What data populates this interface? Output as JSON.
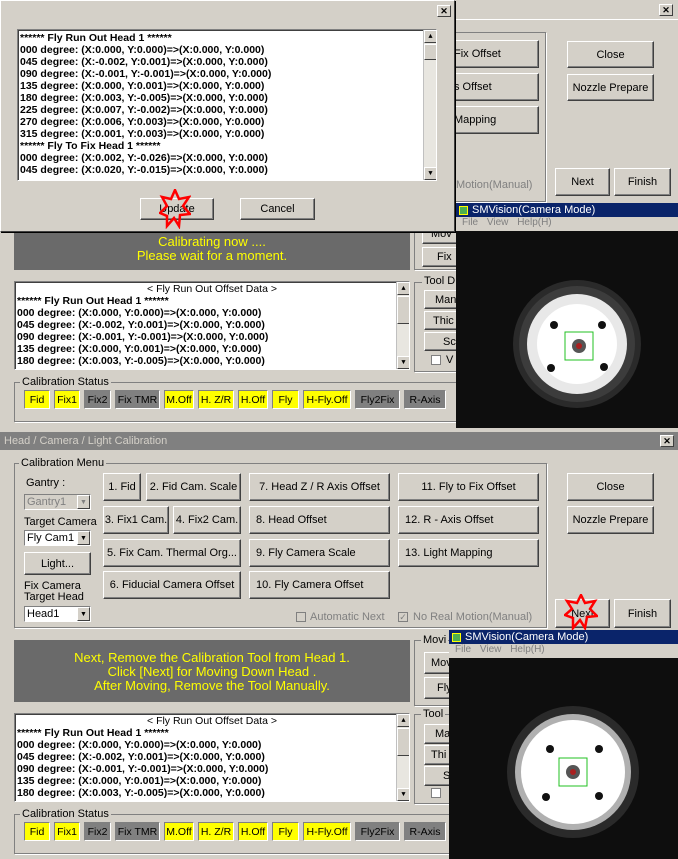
{
  "top": {
    "dialog": {
      "lines": [
        "****** Fly Run Out Head  1 ******",
        "000 degree: (X:0.000, Y:0.000)=>(X:0.000, Y:0.000)",
        "045 degree: (X:-0.002, Y:0.001)=>(X:0.000, Y:0.000)",
        "090 degree: (X:-0.001, Y:-0.001)=>(X:0.000, Y:0.000)",
        "135 degree: (X:0.000, Y:0.001)=>(X:0.000, Y:0.000)",
        "180 degree: (X:0.003, Y:-0.005)=>(X:0.000, Y:0.000)",
        "225 degree: (X:0.007, Y:-0.002)=>(X:0.000, Y:0.000)",
        "270 degree: (X:0.006, Y:0.003)=>(X:0.000, Y:0.000)",
        "315 degree: (X:0.001, Y:0.003)=>(X:0.000, Y:0.000)",
        "****** Fly To Fix Head  1 ******",
        "000 degree: (X:0.002, Y:-0.026)=>(X:0.000, Y:0.000)",
        "045 degree: (X:0.020, Y:-0.015)=>(X:0.000, Y:0.000)"
      ],
      "update_label": "Update",
      "cancel_label": "Cancel"
    },
    "right_buttons": {
      "fix_offset": "Fix Offset",
      "s_offset": "s Offset",
      "mapping": "Mapping",
      "close": "Close",
      "nozzle_prepare": "Nozzle Prepare",
      "next": "Next",
      "finish": "Finish",
      "motion_manual": "Motion(Manual)"
    },
    "message": "Calibrating now ....\nPlease wait for a moment.",
    "offset_title": "< Fly Run Out Offset Data >",
    "offset_lines": [
      "****** Fly Run Out Head  1 ******",
      "000 degree: (X:0.000, Y:0.000)=>(X:0.000, Y:0.000)",
      "045 degree: (X:-0.002, Y:0.001)=>(X:0.000, Y:0.000)",
      "090 degree: (X:-0.001, Y:-0.001)=>(X:0.000, Y:0.000)",
      "135 degree: (X:0.000, Y:0.001)=>(X:0.000, Y:0.000)",
      "180 degree: (X:0.003, Y:-0.005)=>(X:0.000, Y:0.000)"
    ],
    "side": {
      "mov": "Mov",
      "fix": "Fix",
      "tool": "Tool D",
      "man": "Man",
      "thic": "Thic",
      "sc": "Sc",
      "v": "V"
    },
    "camera": {
      "title": "SMVision(Camera Mode)",
      "menu": [
        "File",
        "View",
        "Help(H)"
      ]
    }
  },
  "bottom": {
    "window_title": "Head / Camera / Light Calibration",
    "menu_title": "Calibration Menu",
    "gantry_label": "Gantry :",
    "gantry_value": "Gantry1",
    "target_camera_label": "Target Camera",
    "target_camera_value": "Fly Cam1",
    "light_label": "Light...",
    "fix_camera_label": "Fix Camera",
    "target_head_label": "Target Head",
    "target_head_value": "Head1",
    "calib_buttons": [
      "1. Fid",
      "2. Fid Cam. Scale",
      "7. Head Z / R Axis Offset",
      "11. Fly to Fix Offset",
      "3. Fix1 Cam.",
      "4. Fix2 Cam.",
      "8. Head Offset",
      "12. R - Axis Offset",
      "5. Fix Cam. Thermal Org...",
      "9. Fly Camera Scale",
      "13. Light Mapping",
      "6. Fiducial Camera Offset",
      "10. Fly Camera Offset"
    ],
    "automatic_next": "Automatic Next",
    "no_real_motion": "No Real Motion(Manual)",
    "close": "Close",
    "nozzle_prepare": "Nozzle Prepare",
    "next": "Next",
    "finish": "Finish",
    "message": "Next, Remove the Calibration Tool from Head 1.\nClick [Next] for Moving Down Head .\nAfter Moving, Remove the Tool Manually.",
    "offset_title": "< Fly Run Out Offset Data >",
    "offset_lines": [
      "****** Fly Run Out Head  1 ******",
      "000 degree: (X:0.000, Y:0.000)=>(X:0.000, Y:0.000)",
      "045 degree: (X:-0.002, Y:0.001)=>(X:0.000, Y:0.000)",
      "090 degree: (X:-0.001, Y:-0.001)=>(X:0.000, Y:0.000)",
      "135 degree: (X:0.000, Y:0.001)=>(X:0.000, Y:0.000)",
      "180 degree: (X:0.003, Y:-0.005)=>(X:0.000, Y:0.000)"
    ],
    "side": {
      "movi": "Movi",
      "mov": "Mov",
      "fly": "Fly",
      "tool": "Tool",
      "ma": "Ma",
      "thi": "Thi",
      "s": "S"
    },
    "camera": {
      "title": "SMVision(Camera Mode)",
      "menu": [
        "File",
        "View",
        "Help(H)"
      ]
    }
  },
  "status": {
    "title": "Calibration Status",
    "items": [
      {
        "label": "Fid",
        "color": "#ffff00"
      },
      {
        "label": "Fix1",
        "color": "#ffff00"
      },
      {
        "label": "Fix2",
        "color": "#808080"
      },
      {
        "label": "Fix TMR",
        "color": "#808080"
      },
      {
        "label": "M.Off",
        "color": "#ffff00"
      },
      {
        "label": "H. Z/R",
        "color": "#ffff00"
      },
      {
        "label": "H.Off",
        "color": "#ffff00"
      },
      {
        "label": "Fly",
        "color": "#ffff00"
      },
      {
        "label": "H-Fly.Off",
        "color": "#ffff00"
      },
      {
        "label": "Fly2Fix",
        "color": "#808080"
      },
      {
        "label": "R-Axis",
        "color": "#808080"
      }
    ]
  },
  "colors": {
    "message_bg": "#6a6a6a",
    "message_text": "#ffff00",
    "highlight": "#ff0000",
    "cam_title_bg": "#0a246a"
  }
}
